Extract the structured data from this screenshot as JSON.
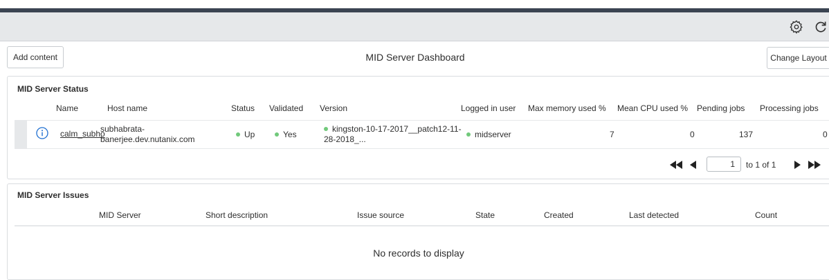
{
  "toolbar": {
    "gear_icon": "gear-icon",
    "refresh_icon": "refresh-icon"
  },
  "dashboard": {
    "title": "MID Server Dashboard",
    "add_content_label": "Add content",
    "change_layout_label": "Change Layout"
  },
  "status_panel": {
    "title": "MID Server Status",
    "columns": [
      "Name",
      "Host name",
      "Status",
      "Validated",
      "Version",
      "Logged in user",
      "Max memory used %",
      "Mean CPU used %",
      "Pending jobs",
      "Processing jobs"
    ],
    "rows": [
      {
        "name": "calm_subho",
        "host_line1": "subhabrata-",
        "host_line2": "banerjee.dev.nutanix.com",
        "status": "Up",
        "validated": "Yes",
        "version_line1": "kingston-10-17-2017__patch12-11-",
        "version_line2": "28-2018_...",
        "logged_in_user": "midserver",
        "max_memory": "7",
        "mean_cpu": "0",
        "pending_jobs": "137",
        "processing_jobs": "0"
      }
    ],
    "status_color": "#71c97b",
    "pager": {
      "current_page": "1",
      "of_text": "to 1 of 1"
    }
  },
  "issues_panel": {
    "title": "MID Server Issues",
    "columns": [
      "MID Server",
      "Short description",
      "Issue source",
      "State",
      "Created",
      "Last detected",
      "Count"
    ],
    "empty_message": "No records to display"
  }
}
